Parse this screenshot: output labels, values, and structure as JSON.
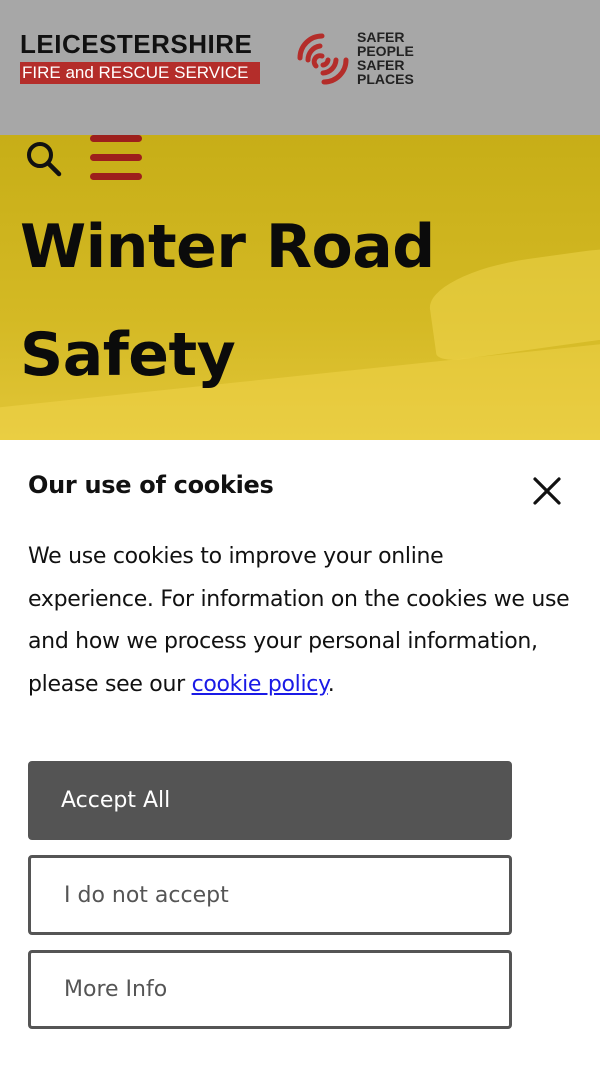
{
  "header": {
    "brand_name": "LEICESTERSHIRE",
    "brand_sub": "FIRE and RESCUE SERVICE",
    "slogan": [
      "SAFER",
      "PEOPLE",
      "SAFER",
      "PLACES"
    ],
    "brand_color": "#b42d2a",
    "icons": [
      "signal-logo-icon"
    ]
  },
  "hero": {
    "title": "Winter Road Safety",
    "background_color": "#c7ae17",
    "icons": [
      "search-icon",
      "hamburger-menu-icon"
    ]
  },
  "cookie_banner": {
    "title": "Our use of cookies",
    "body_text": "We use cookies to improve your online experience. For information on the cookies we use and how we process your personal information, please see our ",
    "policy_link": "cookie policy",
    "body_end": ".",
    "accept_label": "Accept All",
    "reject_label": "I do not accept",
    "more_label": "More Info",
    "close_icon": "close-icon"
  }
}
